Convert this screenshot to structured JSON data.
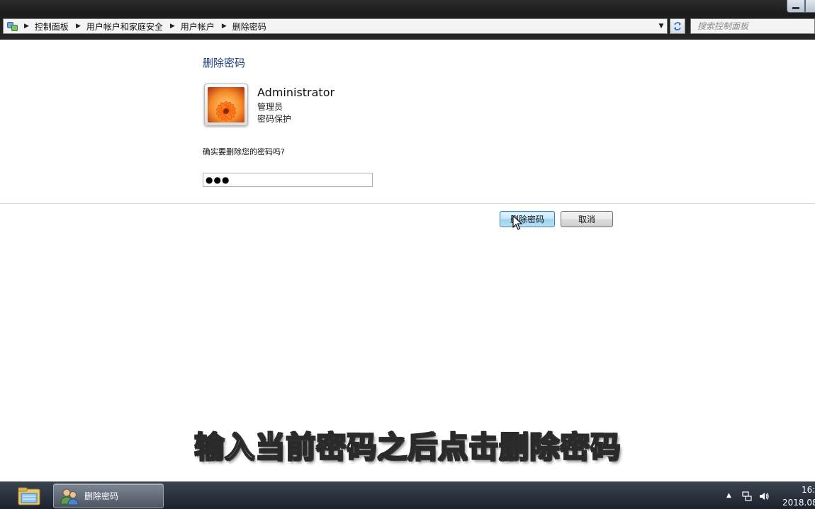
{
  "address_bar": {
    "crumbs": [
      "控制面板",
      "用户帐户和家庭安全",
      "用户帐户",
      "删除密码"
    ],
    "search_placeholder": "搜索控制面板"
  },
  "page": {
    "title": "删除密码",
    "user": {
      "name": "Administrator",
      "role": "管理员",
      "status": "密码保护"
    },
    "question": "确实要删除您的密码吗?",
    "password_mask": "●●●",
    "buttons": {
      "delete": "删除密码",
      "cancel": "取消"
    }
  },
  "subtitle": "输入当前密码之后点击删除密码",
  "taskbar": {
    "active_window_label": "删除密码",
    "clock_time": "16:",
    "clock_date": "2018.08"
  },
  "colors": {
    "title_link": "#1e3f80",
    "primary_button_border": "#3c7fb1"
  },
  "icons": [
    "control-panel-icon",
    "refresh-icon",
    "user-avatar-flower",
    "explorer-folder-icon",
    "users-icon",
    "network-icon",
    "volume-icon"
  ]
}
